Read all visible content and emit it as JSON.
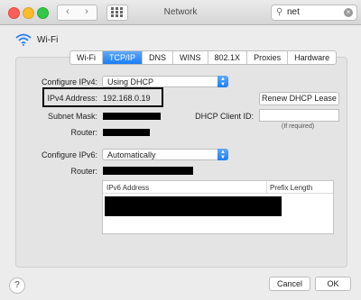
{
  "window": {
    "title": "Network"
  },
  "search": {
    "value": "net",
    "icon": "magnifier"
  },
  "header": {
    "interface_name": "Wi-Fi",
    "icon": "wifi"
  },
  "tabs": [
    "Wi-Fi",
    "TCP/IP",
    "DNS",
    "WINS",
    "802.1X",
    "Proxies",
    "Hardware"
  ],
  "active_tab": "TCP/IP",
  "ipv4": {
    "configure_label": "Configure IPv4:",
    "configure_value": "Using DHCP",
    "address_label": "IPv4 Address:",
    "address_value": "192.168.0.19",
    "subnet_label": "Subnet Mask:",
    "router_label": "Router:",
    "renew_button": "Renew DHCP Lease",
    "client_id_label": "DHCP Client ID:",
    "client_id_hint": "(If required)"
  },
  "ipv6": {
    "configure_label": "Configure IPv6:",
    "configure_value": "Automatically",
    "router_label": "Router:",
    "table_headers": [
      "IPv6 Address",
      "Prefix Length"
    ]
  },
  "footer": {
    "help_label": "?",
    "cancel_label": "Cancel",
    "ok_label": "OK"
  }
}
